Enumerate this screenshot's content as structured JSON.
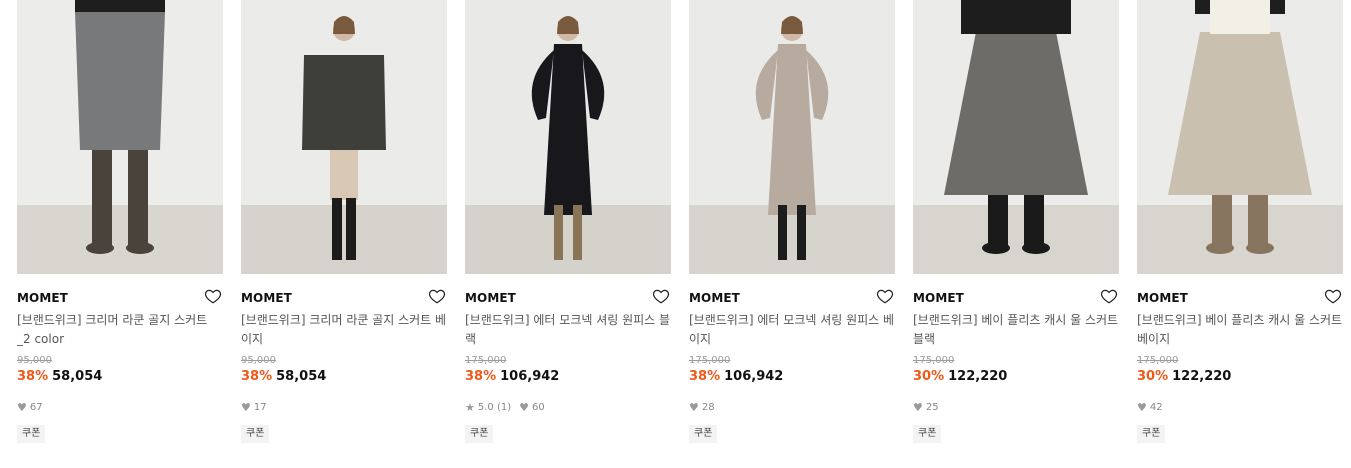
{
  "products": [
    {
      "brand": "MOMET",
      "title": "[브랜드위크] 크리머 라쿤 골지 스커트 _2 color",
      "original_price": "95,000",
      "discount": "38%",
      "price": "58,054",
      "likes": "67",
      "rating": "",
      "reviews": "",
      "coupon": "쿠폰",
      "bg": "#ececea",
      "floor": "#d9d6d0",
      "garment": "#77797b",
      "boots": "#4a433c"
    },
    {
      "brand": "MOMET",
      "title": "[브랜드위크] 크리머 라쿤 골지 스커트 베이지",
      "original_price": "95,000",
      "discount": "38%",
      "price": "58,054",
      "likes": "17",
      "rating": "",
      "reviews": "",
      "coupon": "쿠폰",
      "bg": "#ebebe9",
      "floor": "#d6d3cd",
      "garment": "#3f3f3a",
      "boots": "#1c1c1c"
    },
    {
      "brand": "MOMET",
      "title": "[브랜드위크] 에터 모크넥 셔링 원피스 블랙",
      "original_price": "175,000",
      "discount": "38%",
      "price": "106,942",
      "likes": "60",
      "rating": "5.0",
      "reviews": "(1)",
      "coupon": "쿠폰",
      "bg": "#e9e9e7",
      "floor": "#d5d2cc",
      "garment": "#18181c",
      "boots": "#8a7458"
    },
    {
      "brand": "MOMET",
      "title": "[브랜드위크] 에터 모크넥 셔링 원피스 베이지",
      "original_price": "175,000",
      "discount": "38%",
      "price": "106,942",
      "likes": "28",
      "rating": "",
      "reviews": "",
      "coupon": "쿠폰",
      "bg": "#eaeae8",
      "floor": "#d7d4ce",
      "garment": "#b7aba0",
      "boots": "#1c1c1c"
    },
    {
      "brand": "MOMET",
      "title": "[브랜드위크] 베이 플리츠 캐시 울 스커트 블랙",
      "original_price": "175,000",
      "discount": "30%",
      "price": "122,220",
      "likes": "25",
      "rating": "",
      "reviews": "",
      "coupon": "쿠폰",
      "bg": "#ebebea",
      "floor": "#d8d5cf",
      "garment": "#6d6c68",
      "boots": "#1a1a1a"
    },
    {
      "brand": "MOMET",
      "title": "[브랜드위크] 베이 플리츠 캐시 울 스커트 베이지",
      "original_price": "175,000",
      "discount": "30%",
      "price": "122,220",
      "likes": "42",
      "rating": "",
      "reviews": "",
      "coupon": "쿠폰",
      "bg": "#ebebe9",
      "floor": "#d8d5cf",
      "garment": "#c9c0b0",
      "boots": "#877560"
    }
  ],
  "icons": {
    "wishlist": "heart-outline-icon",
    "likes": "heart-filled-icon",
    "rating": "star-icon"
  }
}
